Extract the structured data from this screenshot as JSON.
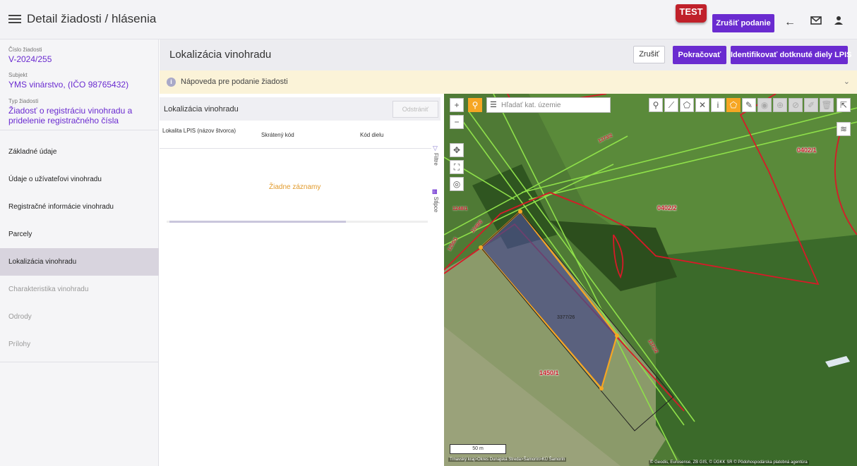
{
  "header": {
    "title": "Detail žiadosti / hlásenia",
    "test_badge": "TEST",
    "cancel_submission_label": "Zrušiť podanie",
    "back_icon": "←",
    "mail_icon": "✉",
    "user_icon": "👤"
  },
  "request": {
    "number_label": "Číslo žiadosti",
    "number_value": "V-2024/255",
    "subject_label": "Subjekt",
    "subject_value": "YMS vinárstvo, (IČO 98765432)",
    "type_label": "Typ žiadosti",
    "type_value": "Žiadosť o registráciu vinohradu a pridelenie registračného čísla"
  },
  "nav": {
    "items": [
      {
        "label": "Základné údaje"
      },
      {
        "label": "Údaje o užívateľovi vinohradu"
      },
      {
        "label": "Registračné informácie vinohradu"
      },
      {
        "label": "Parcely"
      },
      {
        "label": "Lokalizácia vinohradu"
      },
      {
        "label": "Charakteristika vinohradu"
      },
      {
        "label": "Odrody"
      },
      {
        "label": "Prílohy"
      }
    ]
  },
  "page": {
    "title": "Lokalizácia vinohradu",
    "cancel_label": "Zrušiť",
    "continue_label": "Pokračovať",
    "identify_label": "Identifikovať dotknuté diely LPIS",
    "help_text": "Nápoveda pre podanie žiadosti",
    "help_chevron": "⌄"
  },
  "table": {
    "title": "Lokalizácia vinohradu",
    "remove_label": "Odstrániť",
    "columns": [
      "Lokalita LPIS (názov štvorca)",
      "Skrátený kód",
      "Kód dielu"
    ],
    "empty_text": "Žiadne záznamy",
    "filter_label": "Filtre",
    "columns_label": "Stĺpce"
  },
  "map": {
    "search_placeholder": "Hľadať kat. územie",
    "scale_text": "50 m",
    "location_text": "Trnavský kraj>Okres Dunajská Streda>Šamorín>KÚ Šamorín",
    "attribution": "© Geodis, Eurosense, ZB GIS, © ÚGKK SR © Pôdohospodárska platobná agentúra",
    "parcel_labels": [
      "0402/1",
      "0402/2",
      "1450/1",
      "1248/1",
      "1249/2",
      "1250/1",
      "3377/26",
      "1373/2",
      "1372/2"
    ],
    "accent_color": "#f6a623",
    "parcel_line_color": "#d71a28",
    "lpis_line_color": "#8fe04a"
  },
  "colors": {
    "brand": "#6a2bd0",
    "test_badge": "#c0202a",
    "help_bg": "#fbf3d8",
    "active_nav": "#d8d4de"
  }
}
